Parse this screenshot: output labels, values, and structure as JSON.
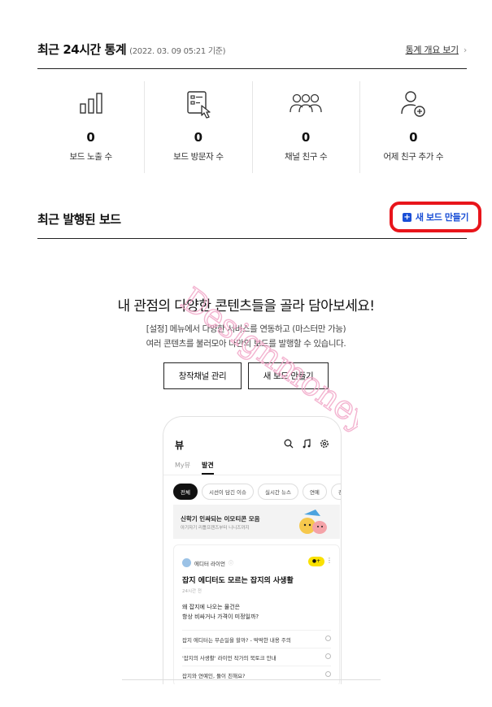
{
  "stats": {
    "title": "최근 24시간 통계",
    "subtitle": "(2022. 03. 09 05:21 기준)",
    "overview_link": "통계 개요 보기",
    "overview_chevron": "›",
    "items": [
      {
        "icon": "bar-chart-icon",
        "value": "0",
        "label": "보드 노출 수"
      },
      {
        "icon": "board-click-icon",
        "value": "0",
        "label": "보드 방문자 수"
      },
      {
        "icon": "people-group-icon",
        "value": "0",
        "label": "채널 친구 수"
      },
      {
        "icon": "add-friend-icon",
        "value": "0",
        "label": "어제 친구 추가 수"
      }
    ]
  },
  "boards": {
    "title": "최근 발행된 보드",
    "new_board_button": "새 보드 만들기"
  },
  "empty_state": {
    "title": "내 관점의 다양한 콘텐츠들을 골라 담아보세요!",
    "desc_line1": "[설정] 메뉴에서 다양한 서비스를 연동하고 (마스터만 가능)",
    "desc_line2": "여러 콘텐츠를 불러모아 나만의 보드를 발행할 수 있습니다.",
    "manage_button": "창작채널 관리",
    "create_button": "새 보드 만들기"
  },
  "watermark_text": "Designmoney?",
  "phone": {
    "header": "뷰",
    "tabs": [
      "My뷰",
      "발견"
    ],
    "chips": [
      "전체",
      "시선이 담긴 이슈",
      "실시간 뉴스",
      "연예",
      "경제"
    ],
    "banner_title": "신학기 인싸되는 이모티콘 모음",
    "banner_sub": "아기자기 리틀프렌즈부터 니니즈까지",
    "author": "에디터 라이언",
    "card_title": "잡지 에디터도 모르는 잡지의 사생활",
    "time": "24시간 전",
    "body_line1": "왜 잡지에 나오는 물건은",
    "body_line2": "항상 비싸거나 가격이 미정일까?",
    "list": [
      "잡지 에디터는 무슨일을 할까? - 딱딱한 내용 주의",
      "'잡지의 사생활' 라이언 작가의 북토크 안내",
      "잡지와 연예인, 둘이 친해요?"
    ]
  }
}
